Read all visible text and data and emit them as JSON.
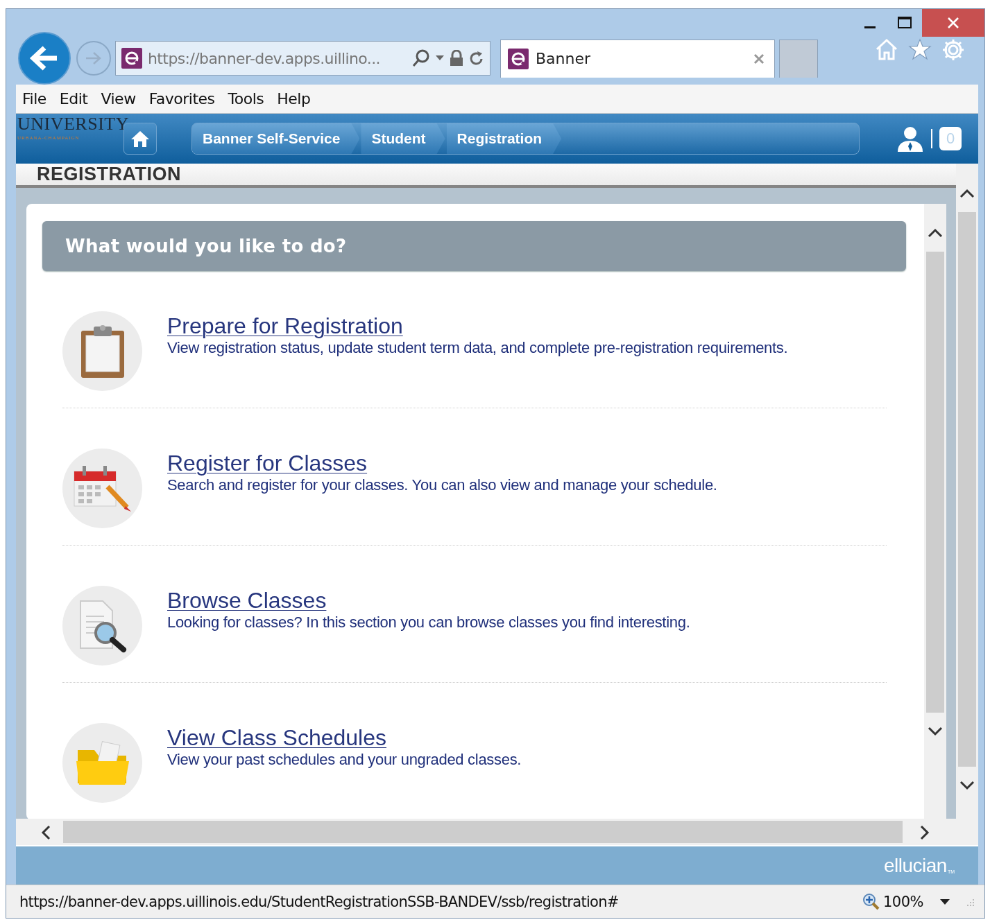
{
  "browser": {
    "address": "https://banner-dev.apps.uillino...",
    "tabs": [
      {
        "title": "Banner",
        "selected": true
      }
    ],
    "menu": [
      "File",
      "Edit",
      "View",
      "Favorites",
      "Tools",
      "Help"
    ]
  },
  "header": {
    "logo": "UNIVERSITY",
    "logo_sub": "URBANA-CHAMPAIGN",
    "breadcrumbs": [
      "Banner Self-Service",
      "Student",
      "Registration"
    ],
    "notification_count": "0"
  },
  "page_title": "REGISTRATION",
  "panel_title": "What would you like to do?",
  "options": [
    {
      "kind": "clipboard",
      "title": "Prepare for Registration",
      "description": "View registration status, update student term data, and complete pre-registration requirements."
    },
    {
      "kind": "calendar",
      "title": "Register for Classes",
      "description": "Search and register for your classes. You can also view and manage your schedule."
    },
    {
      "kind": "search-document",
      "title": "Browse Classes",
      "description": "Looking for classes? In this section you can browse classes you find interesting."
    },
    {
      "kind": "folder",
      "title": "View Class Schedules",
      "description": "View your past schedules and your ungraded classes."
    }
  ],
  "footer": {
    "brand": "ellucian",
    "trademark": "TM"
  },
  "status_bar": {
    "url": "https://banner-dev.apps.uillinois.edu/StudentRegistrationSSB-BANDEV/ssb/registration#",
    "zoom": "100%"
  }
}
